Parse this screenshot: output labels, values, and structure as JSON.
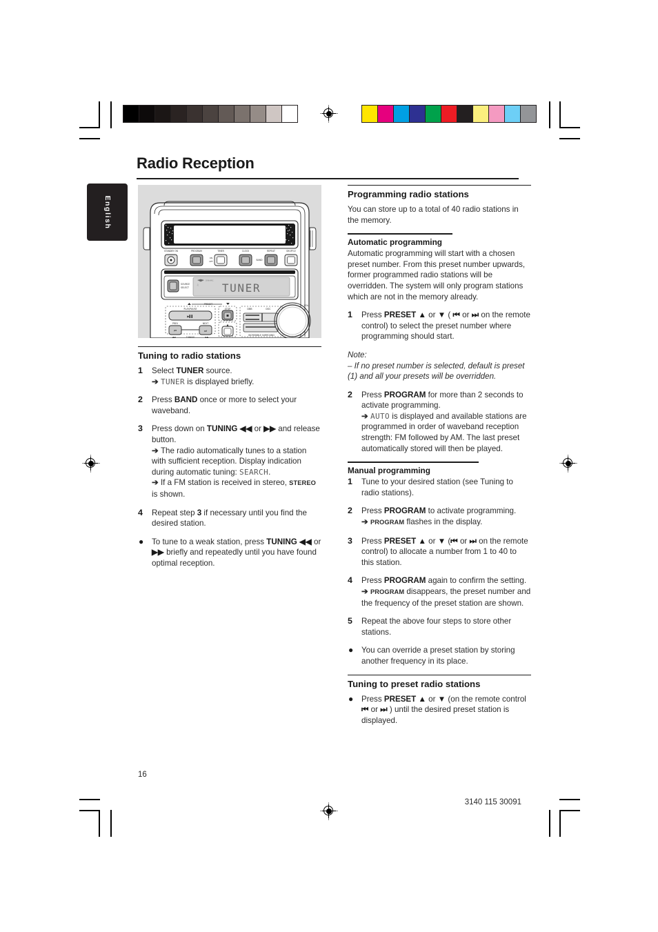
{
  "document": {
    "title": "Radio Reception",
    "language_tab": "English",
    "page_number": "16",
    "doc_code": "3140 115 30091"
  },
  "print_marks": {
    "grayscale_swatches": [
      "#000000",
      "#0d0a0a",
      "#1b1615",
      "#2a2322",
      "#3a3230",
      "#4b4340",
      "#635a56",
      "#7b726d",
      "#958c87",
      "#cfc6c3",
      "#ffffff"
    ],
    "color_swatches": [
      "#ffe500",
      "#e6007e",
      "#00a0e3",
      "#2e3192",
      "#00a14b",
      "#ed1c24",
      "#231f20",
      "#fbef7e",
      "#f49ac1",
      "#6dcff6",
      "#939598"
    ],
    "registration_icon": "registration-crosshair-icon"
  },
  "illustration": {
    "alt": "front panel of the audio system",
    "display_text": "TUNER",
    "source_select_label_line1": "SOURCE",
    "source_select_label_line2": "SELECT",
    "top_buttons": [
      "STANDBY ON",
      "PROGRAM",
      "TIMER",
      "CLOCK",
      "REPEAT",
      "SHUFFLE"
    ],
    "side_labels": {
      "timer_on": "ON",
      "timer_off": "OFF",
      "band": "BAND",
      "dbb": "DBB",
      "dsc": "DSC",
      "vol": "VOL",
      "preset": "PRESET",
      "play_pause": "PLAY/PAUSE",
      "stop": "STOP",
      "prev": "PREV",
      "next": "NEXT",
      "tuning": "TUNING",
      "incredible_surround": "INCREDIBLE SURROUND"
    }
  },
  "left_column": {
    "heading": "Tuning to radio stations",
    "steps": [
      {
        "marker": "1",
        "parts": [
          {
            "t": "Select "
          },
          {
            "t": "TUNER",
            "s": "b"
          },
          {
            "t": " source."
          },
          {
            "t": "\n"
          },
          {
            "t": "➔ ",
            "s": "arrow"
          },
          {
            "t": "TUNER",
            "s": "lcd"
          },
          {
            "t": " is displayed briefly."
          }
        ]
      },
      {
        "marker": "2",
        "parts": [
          {
            "t": "Press "
          },
          {
            "t": "BAND",
            "s": "b"
          },
          {
            "t": " once or more to select your waveband."
          }
        ]
      },
      {
        "marker": "3",
        "parts": [
          {
            "t": "Press down on "
          },
          {
            "t": "TUNING ◀◀",
            "s": "b"
          },
          {
            "t": " or "
          },
          {
            "t": "▶▶",
            "s": "b"
          },
          {
            "t": " and release button."
          },
          {
            "t": "\n"
          },
          {
            "t": "➔ ",
            "s": "arrow"
          },
          {
            "t": "The radio automatically tunes to a station with sufficient reception. Display indication during automatic tuning: "
          },
          {
            "t": "SEARCH",
            "s": "lcd"
          },
          {
            "t": "."
          },
          {
            "t": "\n"
          },
          {
            "t": "➔ ",
            "s": "arrow"
          },
          {
            "t": "If a FM station is received in stereo, "
          },
          {
            "t": "STEREO",
            "s": "smallcap"
          },
          {
            "t": " is shown."
          }
        ]
      },
      {
        "marker": "4",
        "parts": [
          {
            "t": "Repeat step "
          },
          {
            "t": "3",
            "s": "b"
          },
          {
            "t": " if necessary until you find the desired station."
          }
        ]
      },
      {
        "marker": "●",
        "parts": [
          {
            "t": "To tune to a weak station, press "
          },
          {
            "t": "TUNING ◀◀",
            "s": "b"
          },
          {
            "t": " or "
          },
          {
            "t": "▶▶",
            "s": "b"
          },
          {
            "t": " briefly and repeatedly until you have found optimal reception."
          }
        ]
      }
    ]
  },
  "right_column": {
    "programming": {
      "heading": "Programming radio stations",
      "intro": "You can store up to a total of 40 radio stations in the memory.",
      "automatic": {
        "subheading": "Automatic programming",
        "intro": "Automatic programming will start with a chosen preset number. From this preset number upwards, former programmed radio stations will be overridden. The system will only program stations which are not in the memory already.",
        "steps": [
          {
            "marker": "1",
            "parts": [
              {
                "t": "Press "
              },
              {
                "t": "PRESET ▲",
                "s": "b"
              },
              {
                "t": " or "
              },
              {
                "t": "▼",
                "s": "b"
              },
              {
                "t": " ( "
              },
              {
                "t": "⏮",
                "s": "b"
              },
              {
                "t": " or "
              },
              {
                "t": "⏭",
                "s": "b"
              },
              {
                "t": " on the remote control) to select the preset number where programming should start."
              }
            ]
          }
        ],
        "note_label": "Note:",
        "note_text": "–  If no preset number is selected, default is preset (1) and all your presets will be overridden.",
        "steps2": [
          {
            "marker": "2",
            "parts": [
              {
                "t": "Press "
              },
              {
                "t": "PROGRAM",
                "s": "b"
              },
              {
                "t": " for more than 2 seconds to activate programming."
              },
              {
                "t": "\n"
              },
              {
                "t": "➔ ",
                "s": "arrow"
              },
              {
                "t": "AUTO",
                "s": "lcd"
              },
              {
                "t": " is displayed and available stations are programmed in order of waveband reception strength: FM followed by AM. The last preset automatically stored will then be played."
              }
            ]
          }
        ]
      },
      "manual": {
        "subheading": "Manual programming",
        "steps": [
          {
            "marker": "1",
            "parts": [
              {
                "t": "Tune to your desired station (see Tuning to radio stations)."
              }
            ]
          },
          {
            "marker": "2",
            "parts": [
              {
                "t": "Press "
              },
              {
                "t": "PROGRAM",
                "s": "b"
              },
              {
                "t": " to activate programming."
              },
              {
                "t": "\n"
              },
              {
                "t": "➔ ",
                "s": "arrow"
              },
              {
                "t": "PROGRAM",
                "s": "smallcap"
              },
              {
                "t": " flashes in the display."
              }
            ]
          },
          {
            "marker": "3",
            "parts": [
              {
                "t": "Press "
              },
              {
                "t": "PRESET ▲",
                "s": "b"
              },
              {
                "t": " or "
              },
              {
                "t": "▼",
                "s": "b"
              },
              {
                "t": " ("
              },
              {
                "t": "⏮",
                "s": "b"
              },
              {
                "t": " or "
              },
              {
                "t": "⏭",
                "s": "b"
              },
              {
                "t": " on the remote control) to allocate a number from 1 to 40 to this station."
              }
            ]
          },
          {
            "marker": "4",
            "parts": [
              {
                "t": "Press "
              },
              {
                "t": "PROGRAM",
                "s": "b"
              },
              {
                "t": " again to confirm the setting."
              },
              {
                "t": "\n"
              },
              {
                "t": "➔ ",
                "s": "arrow"
              },
              {
                "t": "PROGRAM",
                "s": "smallcap"
              },
              {
                "t": " disappears, the preset number and the frequency of the preset station are shown."
              }
            ]
          },
          {
            "marker": "5",
            "parts": [
              {
                "t": "Repeat the above four steps to store other stations."
              }
            ]
          },
          {
            "marker": "●",
            "parts": [
              {
                "t": "You can override a preset station by storing another frequency in its place."
              }
            ]
          }
        ]
      }
    },
    "preset_tuning": {
      "heading": "Tuning to preset radio stations",
      "steps": [
        {
          "marker": "●",
          "parts": [
            {
              "t": "Press "
            },
            {
              "t": "PRESET ▲",
              "s": "b"
            },
            {
              "t": " or "
            },
            {
              "t": "▼",
              "s": "b"
            },
            {
              "t": " (on the remote control "
            },
            {
              "t": "⏮",
              "s": "b"
            },
            {
              "t": " or "
            },
            {
              "t": "⏭",
              "s": "b"
            },
            {
              "t": " ) until the desired preset station is displayed."
            }
          ]
        }
      ]
    }
  }
}
